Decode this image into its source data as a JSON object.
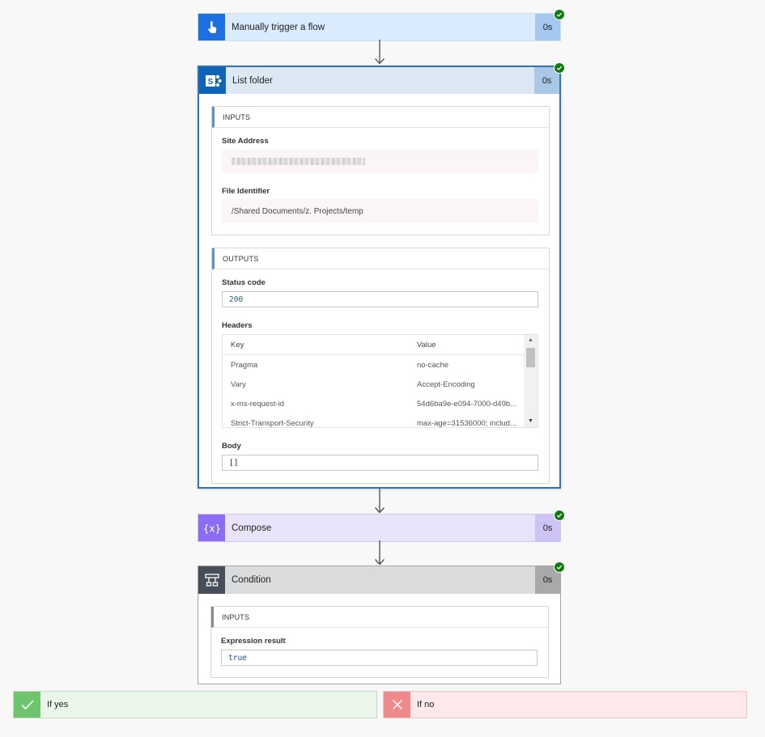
{
  "steps": {
    "trigger": {
      "title": "Manually trigger a flow",
      "duration": "0s",
      "icon": "hand-touch-icon"
    },
    "list_folder": {
      "title": "List folder",
      "duration": "0s",
      "icon": "sharepoint-icon",
      "inputs": {
        "section_title": "INPUTS",
        "site_address_label": "Site Address",
        "file_identifier_label": "File Identifier",
        "file_identifier_value": "/Shared Documents/z. Projects/temp"
      },
      "outputs": {
        "section_title": "OUTPUTS",
        "status_code_label": "Status code",
        "status_code_value": "200",
        "headers_label": "Headers",
        "headers_columns": {
          "key": "Key",
          "value": "Value"
        },
        "headers_rows": [
          {
            "key": "Pragma",
            "value": "no-cache"
          },
          {
            "key": "Vary",
            "value": "Accept-Encoding"
          },
          {
            "key": "x-ms-request-id",
            "value": "54d6ba9e-e094-7000-d49b..."
          },
          {
            "key": "Strict-Transport-Security",
            "value": "max-age=31536000; includ..."
          }
        ],
        "body_label": "Body",
        "body_value": "[]"
      }
    },
    "compose": {
      "title": "Compose",
      "duration": "0s",
      "icon": "expression-braces-icon"
    },
    "condition": {
      "title": "Condition",
      "duration": "0s",
      "icon": "condition-icon",
      "inputs": {
        "section_title": "INPUTS",
        "expression_result_label": "Expression result",
        "expression_result_value": "true"
      }
    }
  },
  "branches": {
    "yes": {
      "label": "If yes",
      "icon": "check-icon"
    },
    "no": {
      "label": "If no",
      "icon": "close-icon"
    }
  },
  "colors": {
    "success": "#107c10",
    "trigger_accent": "#1e6fe2",
    "sharepoint_accent": "#1064b8",
    "compose_accent": "#8c6cf3",
    "condition_accent": "#474e59",
    "yes_accent": "#6ec56e",
    "no_accent": "#f08a8a"
  }
}
